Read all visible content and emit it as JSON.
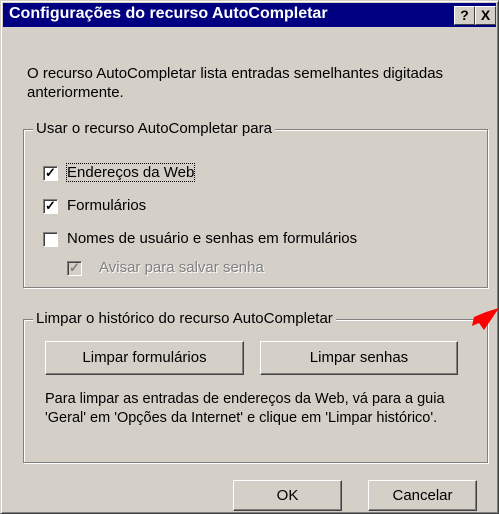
{
  "titlebar": {
    "title": "Configurações do recurso AutoCompletar",
    "help_button": "?",
    "close_button": "X"
  },
  "description": "O recurso AutoCompletar lista entradas semelhantes digitadas anteriormente.",
  "use_group": {
    "legend": "Usar o recurso AutoCompletar para",
    "options": [
      {
        "label": "Endereços da Web",
        "checked": true
      },
      {
        "label": "Formulários",
        "checked": true
      },
      {
        "label": "Nomes de usuário e senhas em formulários",
        "checked": false
      },
      {
        "label": "Avisar para salvar senha",
        "checked": true,
        "disabled": true
      }
    ]
  },
  "clear_group": {
    "legend": "Limpar o histórico do recurso AutoCompletar",
    "clear_forms_button": "Limpar formulários",
    "clear_passwords_button": "Limpar senhas",
    "note": "Para limpar as entradas de endereços da Web, vá para a guia 'Geral' em 'Opções da Internet' e clique em 'Limpar histórico'."
  },
  "footer": {
    "ok_button": "OK",
    "cancel_button": "Cancelar"
  },
  "colors": {
    "titlebar": "#000080",
    "face": "#d4d0c8",
    "annotation_arrow": "#ff0000"
  }
}
